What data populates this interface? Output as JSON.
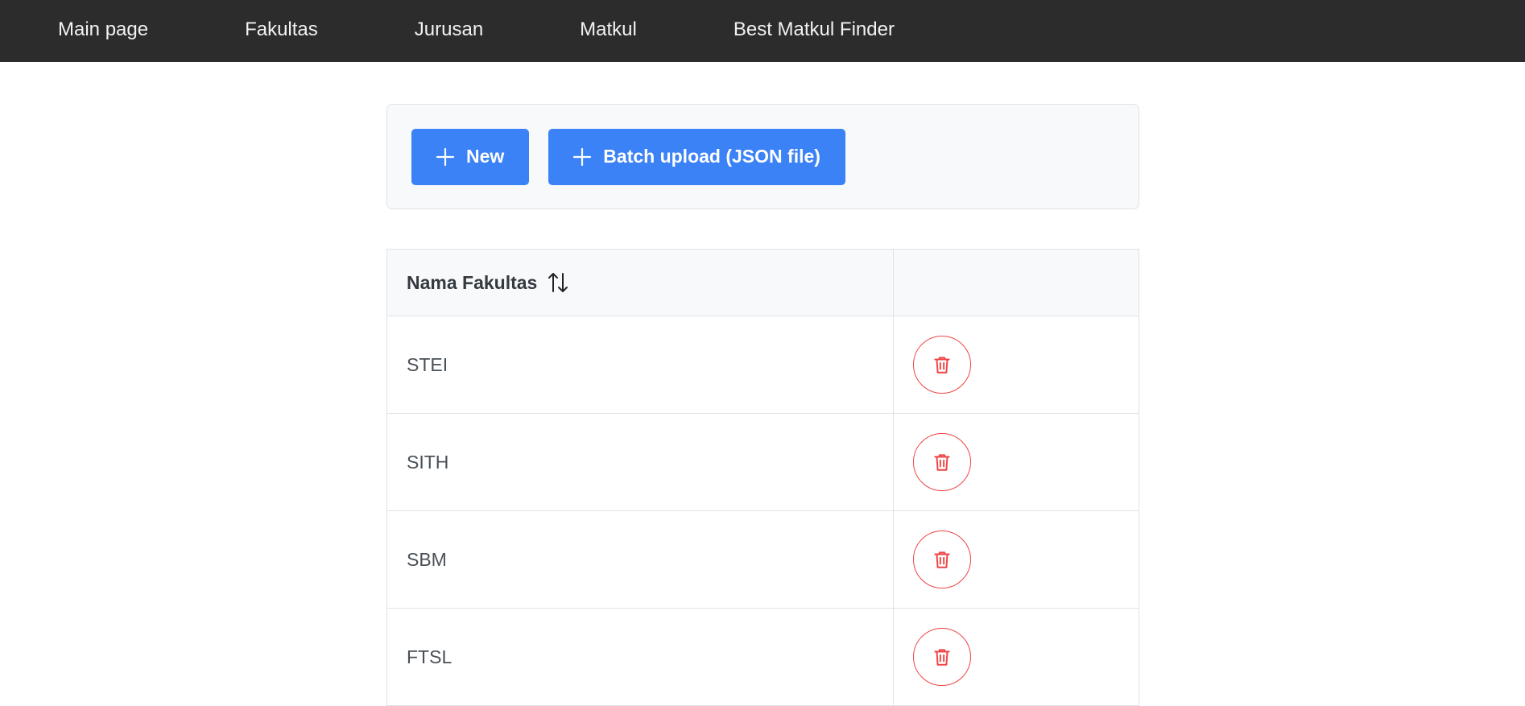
{
  "nav": {
    "items": [
      {
        "label": "Main page"
      },
      {
        "label": "Fakultas"
      },
      {
        "label": "Jurusan"
      },
      {
        "label": "Matkul"
      },
      {
        "label": "Best Matkul Finder"
      }
    ]
  },
  "toolbar": {
    "new_label": "New",
    "batch_label": "Batch upload (JSON file)",
    "icon": "plus-icon"
  },
  "table": {
    "header": {
      "name_col": "Nama Fakultas",
      "sort_icon": "sort-icon"
    },
    "rows": [
      {
        "name": "STEI"
      },
      {
        "name": "SITH"
      },
      {
        "name": "SBM"
      },
      {
        "name": "FTSL"
      }
    ],
    "delete_icon": "trash-icon"
  },
  "colors": {
    "navbar_bg": "#2c2c2c",
    "primary": "#3b82f6",
    "danger": "#ef4444"
  }
}
